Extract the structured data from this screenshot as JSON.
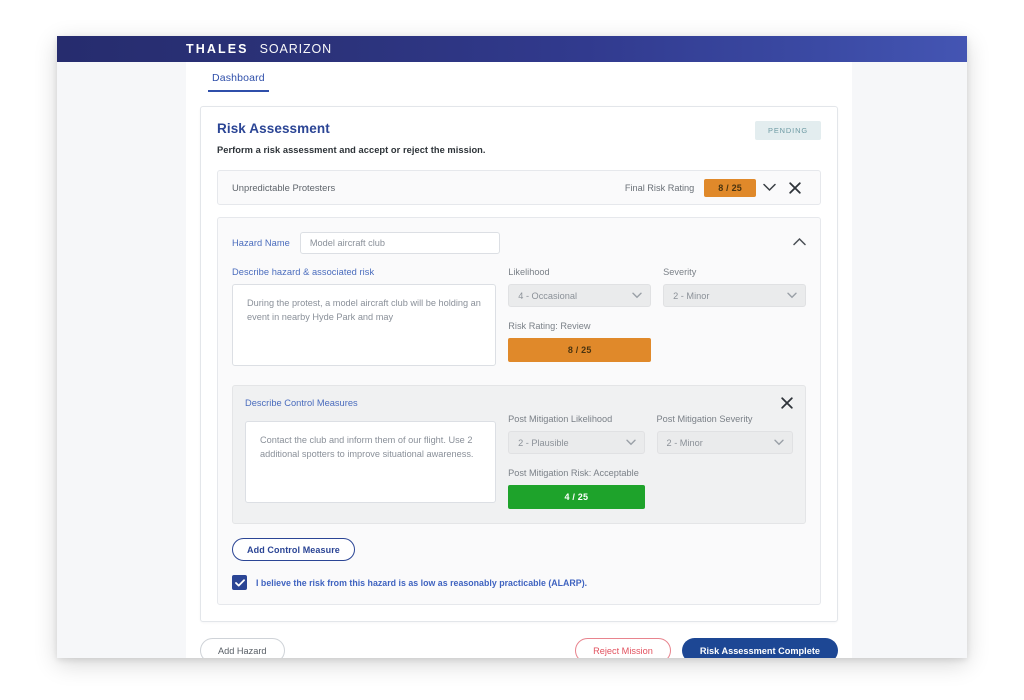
{
  "brand": {
    "primary": "THALES",
    "secondary": "SOARIZON"
  },
  "tabs": [
    {
      "label": "Dashboard"
    }
  ],
  "page": {
    "title": "Risk Assessment",
    "subtitle": "Perform a risk assessment and accept or reject the mission.",
    "status_badge": "PENDING"
  },
  "hazard_summary": {
    "name": "Unpredictable Protesters",
    "rating_label": "Final Risk Rating",
    "rating_value": "8 / 25"
  },
  "hazard_detail": {
    "name_label": "Hazard Name",
    "name_value": "Model aircraft club",
    "describe_label": "Describe hazard & associated risk",
    "describe_value": "During the protest, a model aircraft club will be holding an event in nearby Hyde Park and may",
    "likelihood_label": "Likelihood",
    "likelihood_value": "4 - Occasional",
    "severity_label": "Severity",
    "severity_value": "2 - Minor",
    "risk_rating_label": "Risk Rating: Review",
    "risk_rating_value": "8 / 25"
  },
  "control_measure": {
    "title": "Describe Control Measures",
    "measures_value": "Contact the club and inform them of our flight. Use 2 additional spotters to improve situational awareness.",
    "post_likelihood_label": "Post Mitigation Likelihood",
    "post_likelihood_value": "2 - Plausible",
    "post_severity_label": "Post Mitigation Severity",
    "post_severity_value": "2 - Minor",
    "post_risk_label": "Post Mitigation Risk: Acceptable",
    "post_risk_value": "4 / 25"
  },
  "actions": {
    "add_control_measure": "Add Control Measure",
    "alarp_text": "I believe the risk from this hazard is as low as reasonably practicable (ALARP).",
    "add_hazard": "Add Hazard",
    "reject_mission": "Reject Mission",
    "complete": "Risk Assessment Complete"
  },
  "colors": {
    "brand_navy": "#262c6e",
    "accent_blue": "#2b4595",
    "link_blue": "#4a6cbd",
    "risk_orange": "#e0892a",
    "risk_green": "#1ea32b",
    "reject_red": "#e2525f",
    "pending_teal": "#6d9aa3"
  }
}
